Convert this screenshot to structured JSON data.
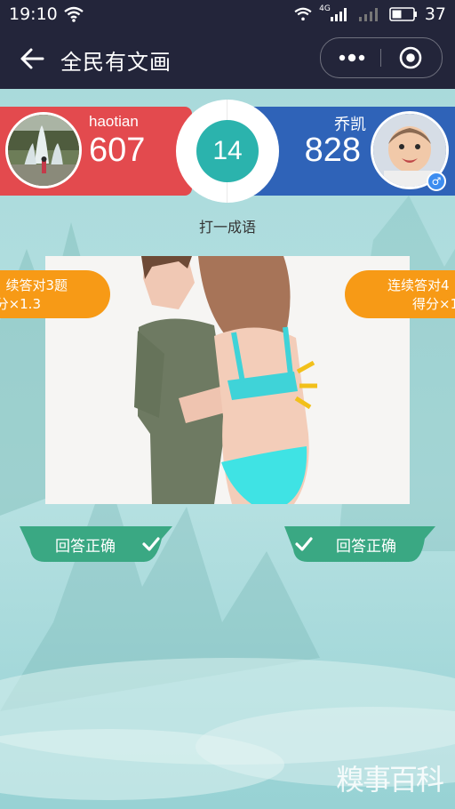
{
  "status_bar": {
    "time": "19:10",
    "network": "4G",
    "battery": "37"
  },
  "title_bar": {
    "title": "全民有文画",
    "back_icon": "arrow-left-icon",
    "more_icon": "more-dots-icon",
    "close_icon": "target-circle-icon"
  },
  "players": {
    "left": {
      "name": "haotian",
      "score": "607",
      "color": "#e34a4e"
    },
    "right": {
      "name": "乔凯",
      "score": "828",
      "color": "#2f63b8",
      "gender_symbol": "♂"
    }
  },
  "timer": {
    "value": "14",
    "color": "#2bb3ad"
  },
  "question": {
    "prompt": "打一成语"
  },
  "streak_bonus": {
    "left": {
      "line1": "续答对3题",
      "line2": "分×1.3"
    },
    "right": {
      "line1": "连续答对4",
      "line2": "得分×1"
    },
    "color": "#f79a16"
  },
  "answers": {
    "left": {
      "label": "回答正确"
    },
    "right": {
      "label": "回答正确"
    },
    "color": "#3aa883"
  },
  "watermark": {
    "text": "糗事百科"
  }
}
